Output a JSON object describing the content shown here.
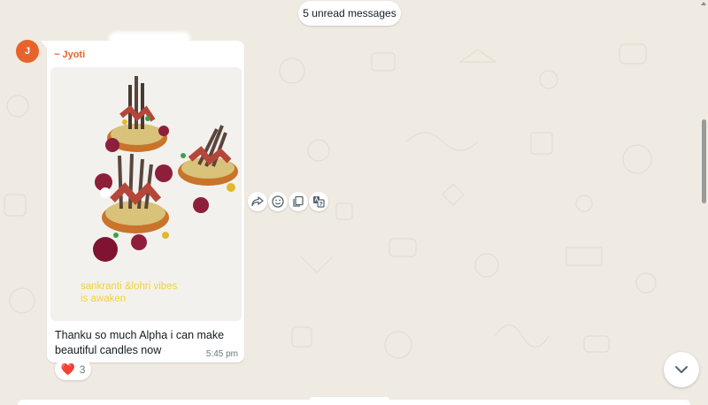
{
  "chat": {
    "unread_banner": "5 unread messages"
  },
  "message": {
    "avatar_initial": "J",
    "sender": "~ Jyoti",
    "image_caption": "sankranti &lohri vibes is awaken",
    "text": "Thanku so much Alpha i can make beautiful candles now",
    "time": "5:45 pm"
  },
  "reaction": {
    "emoji": "❤️",
    "count": "3"
  },
  "actions": {
    "icons": [
      "forward-icon",
      "emoji-icon",
      "copy-icon",
      "translate-icon"
    ]
  },
  "colors": {
    "background": "#efeae2",
    "bubble": "#ffffff",
    "sender_name": "#e8632b",
    "time": "#667781"
  }
}
